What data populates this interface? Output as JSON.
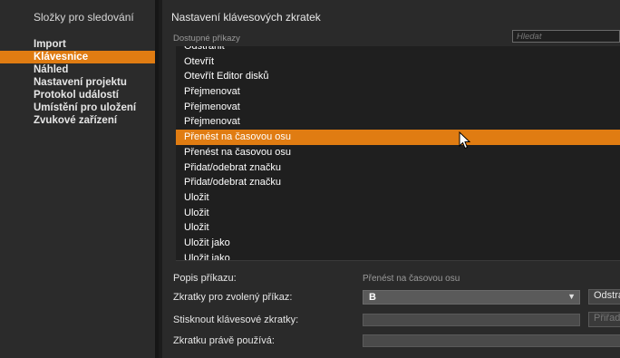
{
  "sidebar": {
    "title": "Složky pro sledování",
    "items": [
      {
        "label": "Import",
        "selected": false
      },
      {
        "label": "Klávesnice",
        "selected": true
      },
      {
        "label": "Náhled",
        "selected": false
      },
      {
        "label": "Nastavení projektu",
        "selected": false
      },
      {
        "label": "Protokol událostí",
        "selected": false
      },
      {
        "label": "Umístění pro uložení",
        "selected": false
      },
      {
        "label": "Zvukové zařízení",
        "selected": false
      }
    ]
  },
  "main": {
    "title": "Nastavení klávesových zkratek",
    "commands_label": "Dostupné příkazy",
    "search": {
      "placeholder": "Hledat",
      "value": ""
    },
    "commands": [
      "Odstranit",
      "Otevřít",
      "Otevřít Editor disků",
      "Přejmenovat",
      "Přejmenovat",
      "Přejmenovat",
      "Přenést na časovou osu",
      "Přenést na časovou osu",
      "Přidat/odebrat značku",
      "Přidat/odebrat značku",
      "Uložit",
      "Uložit",
      "Uložit",
      "Uložit jako",
      "Uložit jako"
    ],
    "selected_command_index": 6,
    "description_label": "Popis příkazu:",
    "description_value": "Přenést na časovou osu",
    "shortcut_label": "Zkratky pro zvolený příkaz:",
    "shortcut_value": "B",
    "remove_button": "Odstranit",
    "press_label": "Stisknout klávesové zkratky:",
    "assign_button": "Přiřadit",
    "used_by_label": "Zkratku právě používá:"
  },
  "colors": {
    "accent": "#e07c12",
    "background": "#2a2a2a",
    "list_background": "#1f1f1f"
  }
}
